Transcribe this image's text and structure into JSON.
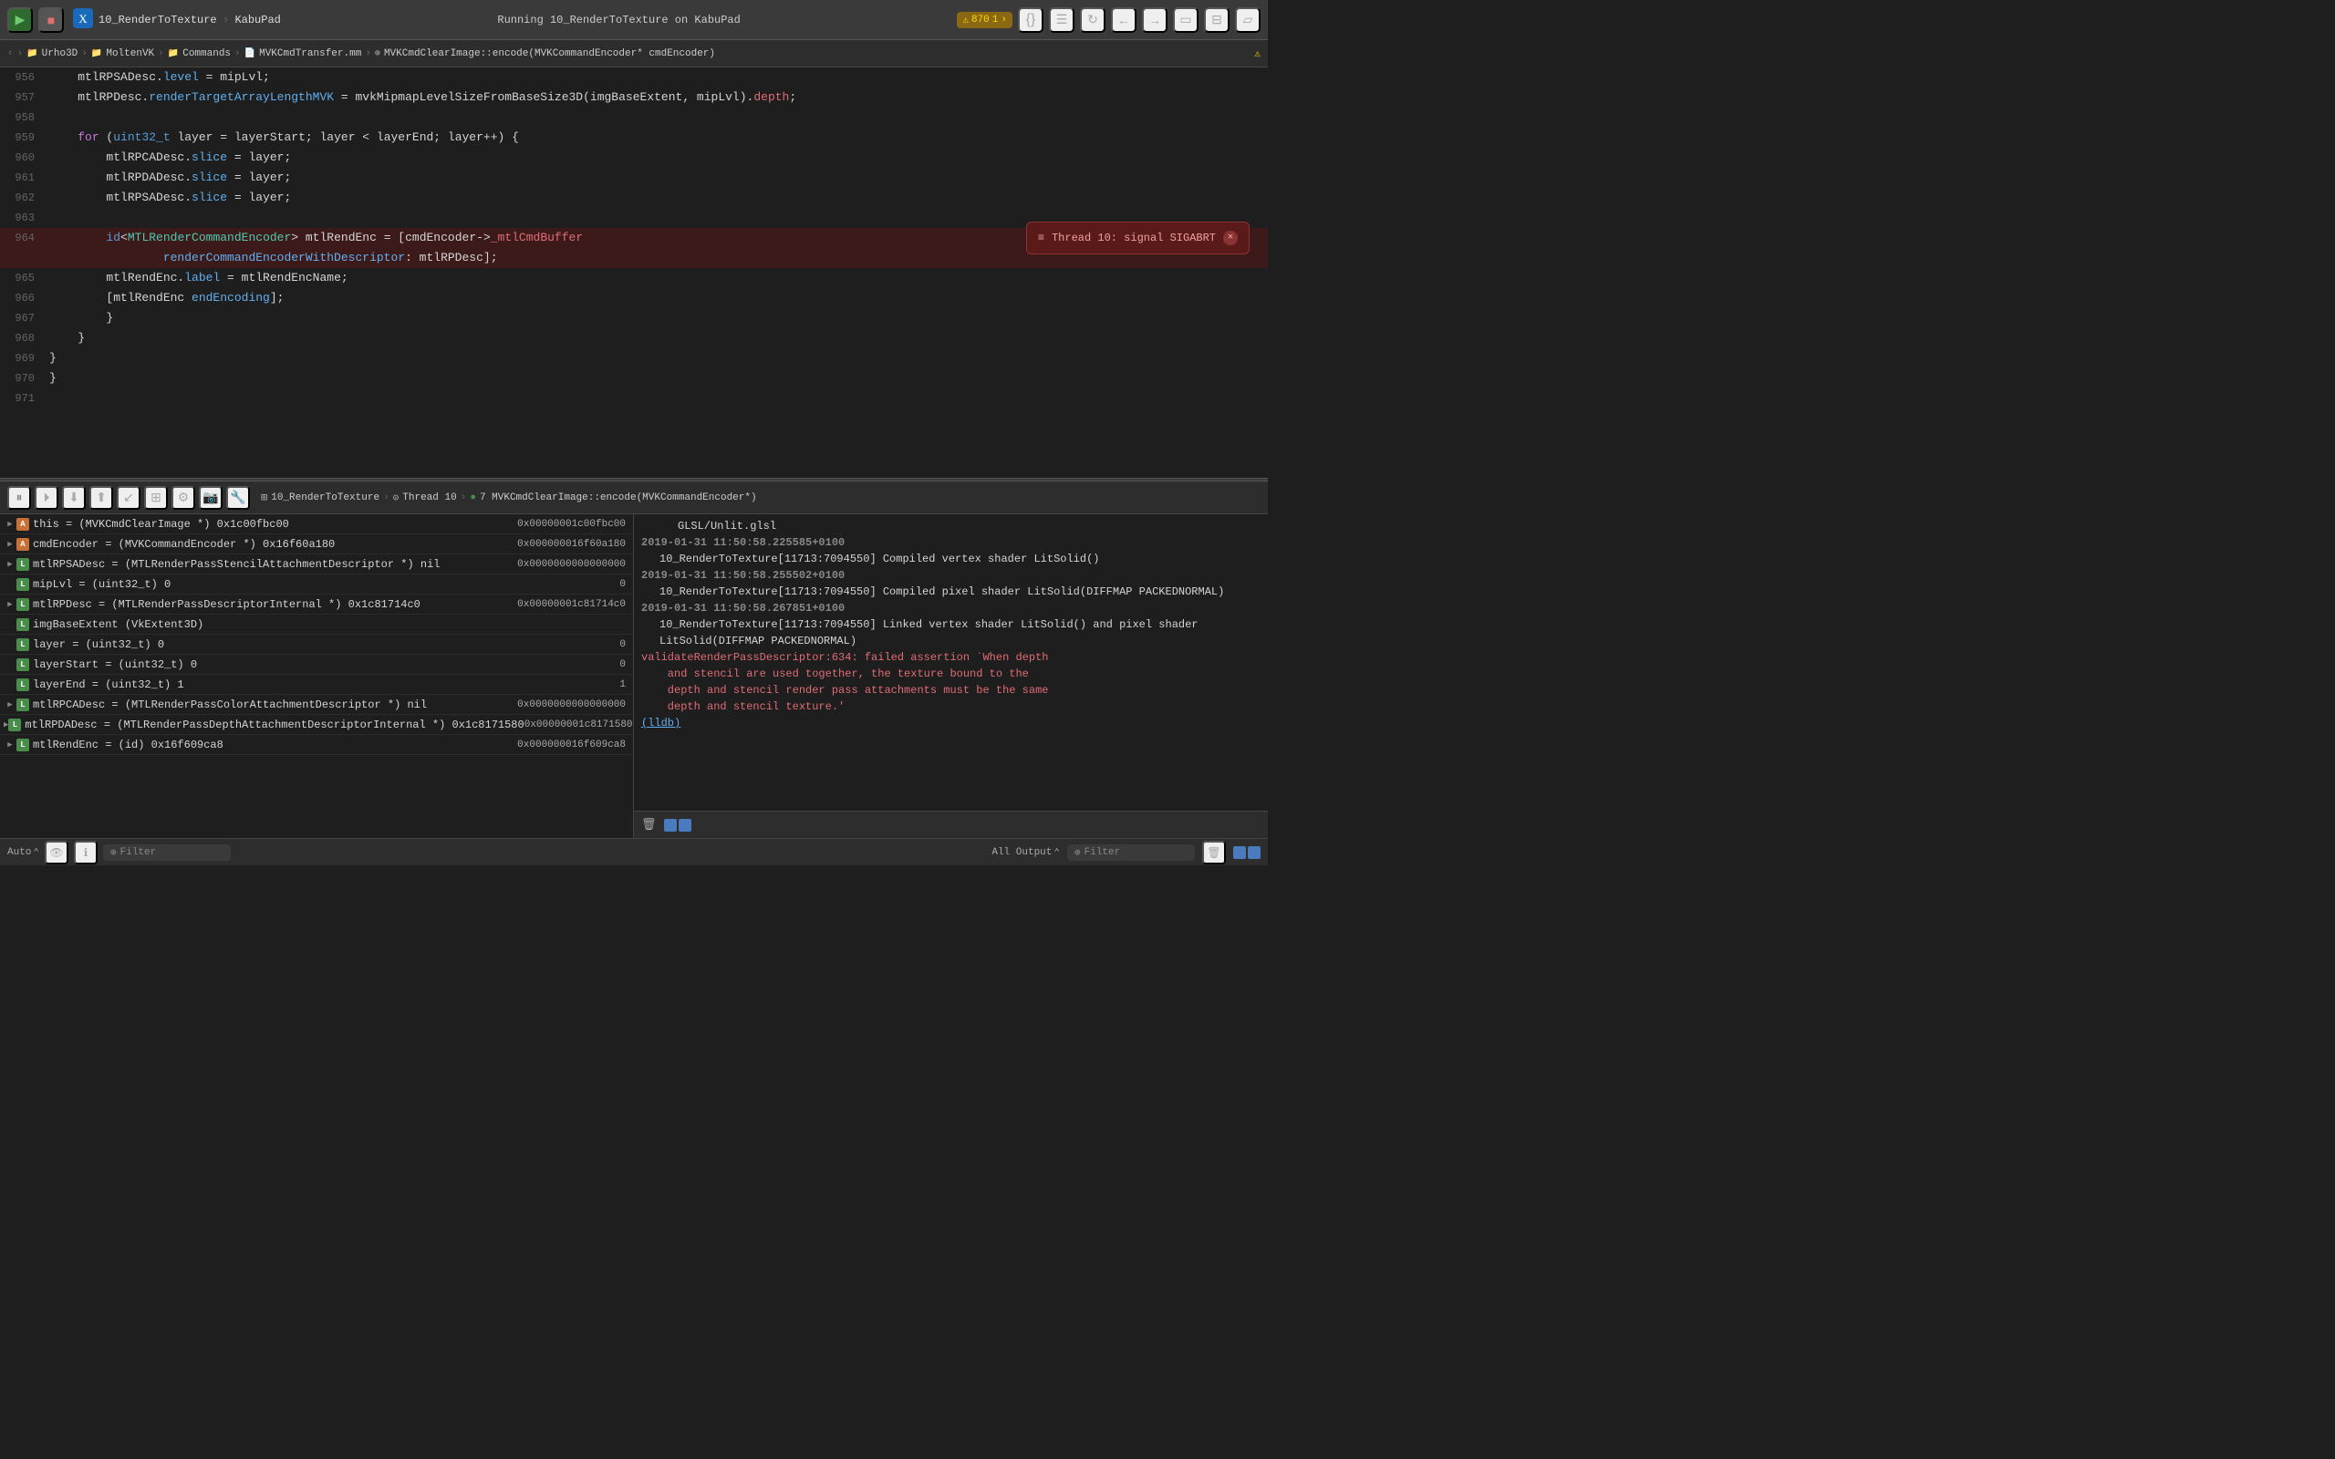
{
  "toolbar": {
    "run_label": "▶",
    "stop_label": "■",
    "title": "Running 10_RenderToTexture on KabuPad",
    "project": "10_RenderToTexture",
    "scheme": "KabuPad",
    "warning_count": "870",
    "error_count": "1"
  },
  "breadcrumb": {
    "items": [
      "Urho3D",
      "MoltenVK",
      "Commands",
      "MVKCmdTransfer.mm",
      "MVKCmdClearImage::encode(MVKCommandEncoder* cmdEncoder)"
    ]
  },
  "code": {
    "lines": [
      {
        "num": "956",
        "content": "    mtlRPSADesc.level = mipLvl;",
        "highlight": false
      },
      {
        "num": "957",
        "content": "    mtlRPDesc.renderTargetArrayLengthMVK = mvkMipmapLevelSizeFromBaseSize3D(imgBaseExtent, mipLvl).depth;",
        "highlight": false
      },
      {
        "num": "958",
        "content": "",
        "highlight": false
      },
      {
        "num": "959",
        "content": "    for (uint32_t layer = layerStart; layer < layerEnd; layer++) {",
        "highlight": false
      },
      {
        "num": "960",
        "content": "        mtlRPCADesc.slice = layer;",
        "highlight": false
      },
      {
        "num": "961",
        "content": "        mtlRPDADesc.slice = layer;",
        "highlight": false
      },
      {
        "num": "962",
        "content": "        mtlRPSADesc.slice = layer;",
        "highlight": false
      },
      {
        "num": "963",
        "content": "",
        "highlight": false
      },
      {
        "num": "964",
        "content": "        id<MTLRenderCommandEncoder> mtlRendEnc = [cmdEncoder->_mtlCmdBuffer",
        "highlight": true
      },
      {
        "num": "",
        "content": "                renderCommandEncoderWithDescriptor: mtlRPDesc];",
        "highlight": true
      },
      {
        "num": "965",
        "content": "        mtlRendEnc.label = mtlRendEncName;",
        "highlight": false
      },
      {
        "num": "966",
        "content": "        [mtlRendEnc endEncoding];",
        "highlight": false
      },
      {
        "num": "967",
        "content": "        }",
        "highlight": false
      },
      {
        "num": "968",
        "content": "    }",
        "highlight": false
      },
      {
        "num": "969",
        "content": "}",
        "highlight": false
      },
      {
        "num": "970",
        "content": "}",
        "highlight": false
      },
      {
        "num": "971",
        "content": "",
        "highlight": false
      }
    ],
    "error_tooltip": {
      "text": "Thread 10: signal SIGABRT",
      "icon": "≡"
    }
  },
  "debug_toolbar": {
    "breadcrumb_items": [
      "10_RenderToTexture",
      "Thread 10",
      "7 MVKCmdClearImage::encode(MVKCommandEncoder*)"
    ]
  },
  "variables": [
    {
      "expand": true,
      "icon": "A",
      "icon_color": "orange",
      "name": "this = (MVKCmdClearImage *) 0x1c00fbc00",
      "value": "0x00000001c00fbc00"
    },
    {
      "expand": true,
      "icon": "A",
      "icon_color": "orange",
      "name": "cmdEncoder = (MVKCommandEncoder *) 0x16f60a180",
      "value": "0x000000016f60a180"
    },
    {
      "expand": true,
      "icon": "L",
      "icon_color": "green",
      "name": "mtlRPSADesc = (MTLRenderPassStencilAttachmentDescriptor *) nil",
      "value": "0x0000000000000000"
    },
    {
      "expand": false,
      "icon": "L",
      "icon_color": "green",
      "name": "mipLvl = (uint32_t) 0",
      "value": "0"
    },
    {
      "expand": true,
      "icon": "L",
      "icon_color": "green",
      "name": "mtlRPDesc = (MTLRenderPassDescriptorInternal *) 0x1c81714c0",
      "value": "0x00000001c81714c0"
    },
    {
      "expand": false,
      "icon": "L",
      "icon_color": "green",
      "name": "imgBaseExtent (VkExtent3D)",
      "value": ""
    },
    {
      "expand": false,
      "icon": "L",
      "icon_color": "green",
      "name": "layer = (uint32_t) 0",
      "value": "0"
    },
    {
      "expand": false,
      "icon": "L",
      "icon_color": "green",
      "name": "layerStart = (uint32_t) 0",
      "value": "0"
    },
    {
      "expand": false,
      "icon": "L",
      "icon_color": "green",
      "name": "layerEnd = (uint32_t) 1",
      "value": "1"
    },
    {
      "expand": true,
      "icon": "L",
      "icon_color": "green",
      "name": "mtlRPCADesc = (MTLRenderPassColorAttachmentDescriptor *) nil",
      "value": "0x0000000000000000"
    },
    {
      "expand": true,
      "icon": "L",
      "icon_color": "green",
      "name": "mtlRPDADesc = (MTLRenderPassDepthAttachmentDescriptorInternal *) 0x1c8171580",
      "value": "0x00000001c8171580"
    },
    {
      "expand": true,
      "icon": "L",
      "icon_color": "green",
      "name": "mtlRendEnc = (id) 0x16f609ca8",
      "value": "0x000000016f609ca8"
    }
  ],
  "log": {
    "entries": [
      {
        "text": "GLSL/Unlit.glsl",
        "type": "normal"
      },
      {
        "timestamp": "2019-01-31 11:50:58.225585+0100",
        "type": "timestamp"
      },
      {
        "text": "    10_RenderToTexture[11713:7094550] Compiled vertex shader LitSolid()",
        "type": "normal"
      },
      {
        "timestamp": "2019-01-31 11:50:58.255502+0100",
        "type": "timestamp"
      },
      {
        "text": "    10_RenderToTexture[11713:7094550] Compiled pixel shader LitSolid(DIFFMAP PACKEDNORMAL)",
        "type": "normal"
      },
      {
        "timestamp": "2019-01-31 11:50:58.267851+0100",
        "type": "timestamp"
      },
      {
        "text": "    10_RenderToTexture[11713:7094550] Linked vertex shader LitSolid() and pixel shader LitSolid(DIFFMAP PACKEDNORMAL)",
        "type": "normal"
      },
      {
        "text": "validateRenderPassDescriptor:634: failed assertion `When depth and stencil are used together, the texture bound to the depth and stencil render pass attachments must be the same depth and stencil texture.'",
        "type": "error"
      },
      {
        "text": "(lldb)",
        "type": "link"
      }
    ]
  },
  "status_bar": {
    "auto_label": "Auto",
    "filter_placeholder": "Filter",
    "all_output_label": "All Output",
    "filter_placeholder2": "Filter",
    "eye_icon": "👁",
    "info_icon": "ℹ"
  }
}
